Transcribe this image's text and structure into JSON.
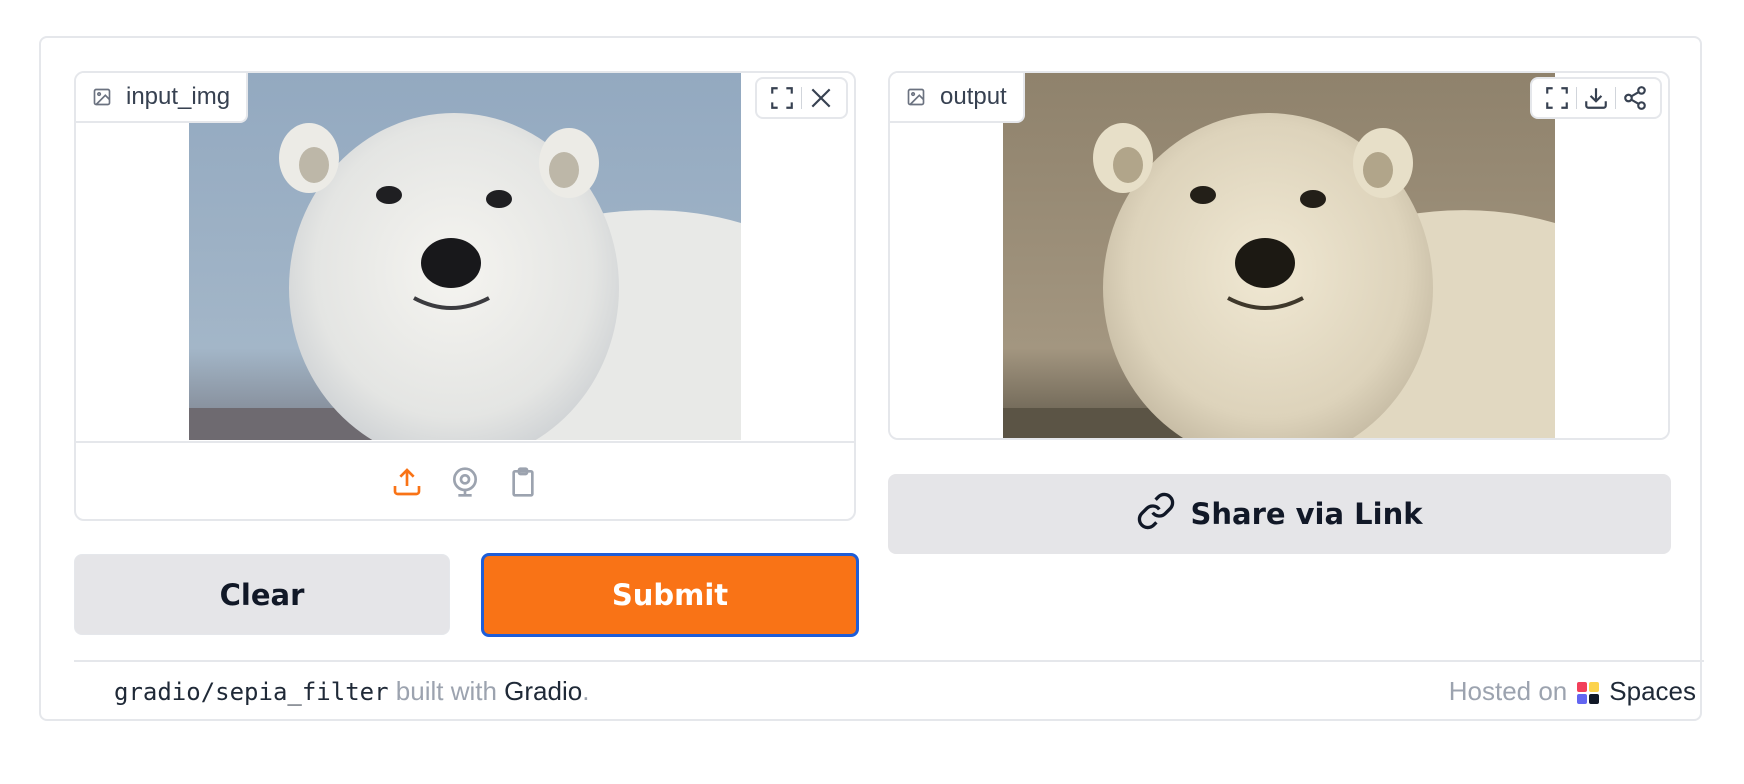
{
  "input_panel": {
    "label": "input_img",
    "label_icon": "image-icon",
    "toolbar_icons": [
      "fullscreen-icon",
      "close-icon"
    ],
    "source_icons": [
      "upload-icon",
      "webcam-icon",
      "clipboard-icon"
    ],
    "image_alt": "polar bear photo"
  },
  "output_panel": {
    "label": "output",
    "label_icon": "image-icon",
    "toolbar_icons": [
      "fullscreen-icon",
      "download-icon",
      "share-icon"
    ],
    "image_alt": "polar bear photo with sepia filter"
  },
  "buttons": {
    "clear": "Clear",
    "submit": "Submit",
    "share": "Share via Link"
  },
  "footer": {
    "repo": "gradio/sepia_filter",
    "built_with": " built with ",
    "gradio": "Gradio",
    "period": ".",
    "hosted_on": "Hosted on",
    "spaces": "Spaces"
  },
  "colors": {
    "accent": "#f97316",
    "submit_border": "#1d5dd8",
    "secondary_button": "#e5e5e8",
    "border": "#e5e7eb"
  }
}
